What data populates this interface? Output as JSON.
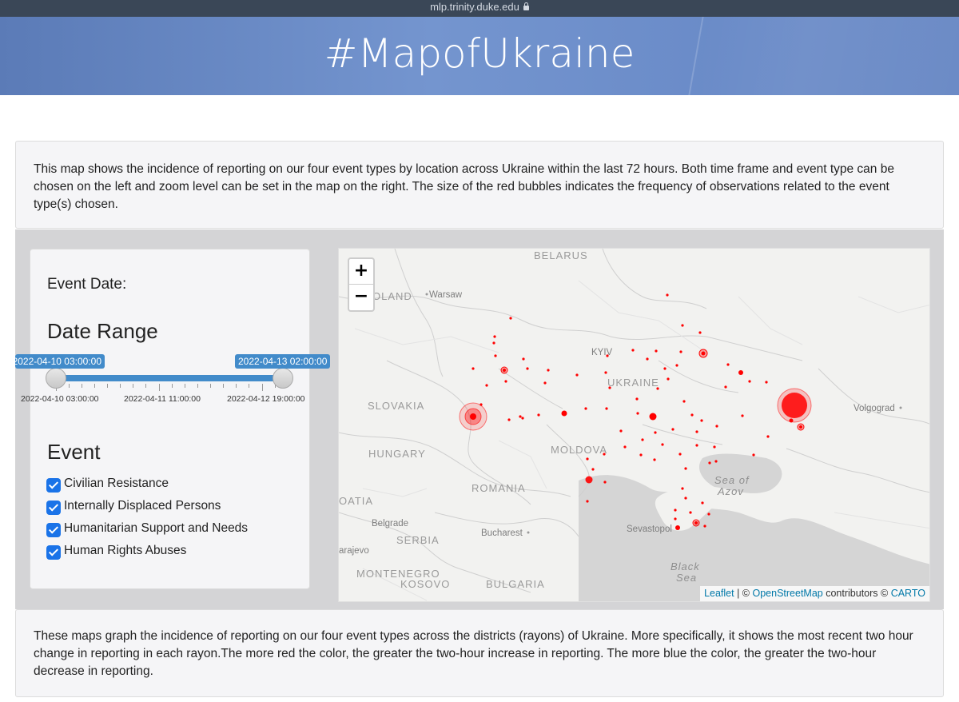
{
  "browser": {
    "url": "mlp.trinity.duke.edu"
  },
  "header": {
    "title": "#MapofUkraine"
  },
  "intro": {
    "text": "This map shows the incidence of reporting on our four event types by location across Ukraine within the last 72 hours. Both time frame and event type can be chosen on the left and zoom level can be set in the map on the right. The size of the red bubbles indicates the frequency of observations related to the event type(s) chosen."
  },
  "sidebar": {
    "event_date_label": "Event Date:",
    "date_range_label": "Date Range",
    "slider": {
      "from_value": "2022-04-10 03:00:00",
      "to_value": "2022-04-13 02:00:00",
      "tick_labels": [
        "2022-04-10 03:00:00",
        "2022-04-11 11:00:00",
        "2022-04-12 19:00:00"
      ]
    },
    "event_label": "Event",
    "events": [
      {
        "label": "Civilian Resistance",
        "checked": true
      },
      {
        "label": "Internally Displaced Persons",
        "checked": true
      },
      {
        "label": "Humanitarian Support and Needs",
        "checked": true
      },
      {
        "label": "Human Rights Abuses",
        "checked": true
      }
    ]
  },
  "map": {
    "zoom_in": "+",
    "zoom_out": "−",
    "bubble_color": "#ff0000",
    "country_labels": [
      "BELARUS",
      "OLAND",
      "UKRAINE",
      "SLOVAKIA",
      "HUNGARY",
      "MOLDOVA",
      "ROMANIA",
      "SERBIA",
      "MONTENEGRO",
      "KOSOVO",
      "BULGARIA",
      "OATIA"
    ],
    "city_labels": [
      "Warsaw",
      "KYIV",
      "Volgograd",
      "Belgrade",
      "Bucharest",
      "Sevastopol",
      "arajevo"
    ],
    "sea_labels": {
      "azov_1": "Sea of",
      "azov_2": "Azov",
      "black_1": "Black",
      "black_2": "Sea"
    },
    "attribution": {
      "leaflet": "Leaflet",
      "sep": " | © ",
      "osm": "OpenStreetMap",
      "mid": " contributors © ",
      "carto": "CARTO"
    }
  },
  "outro": {
    "text": "These maps graph the incidence of reporting on our four event types across the districts (rayons) of Ukraine. More specifically, it shows the most recent two hour change in reporting in each rayon.The more red the color, the greater the two-hour increase in reporting. The more blue the color, the greater the two-hour decrease in reporting."
  }
}
